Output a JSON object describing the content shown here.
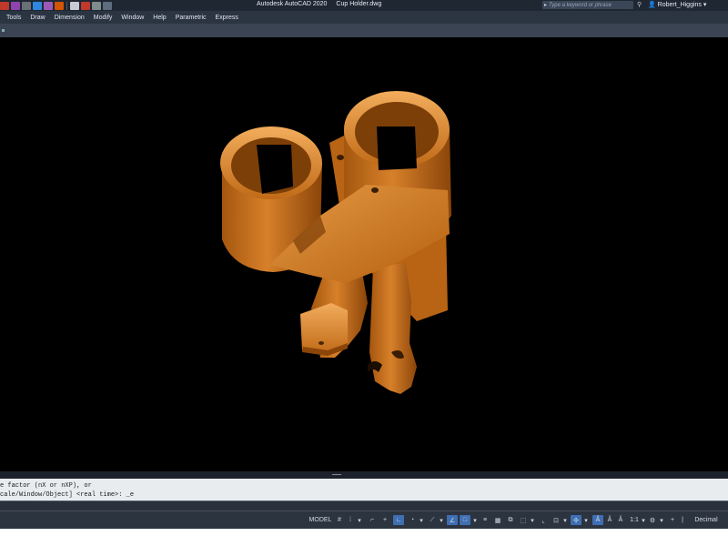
{
  "title": {
    "app": "Autodesk AutoCAD 2020",
    "file": "Cup Holder.dwg"
  },
  "search": {
    "placeholder": "Type a keyword or phrase"
  },
  "user": {
    "name": "Robert_Higgins"
  },
  "menu": {
    "items": [
      "Tools",
      "Draw",
      "Dimension",
      "Modify",
      "Window",
      "Help",
      "Parametric",
      "Express"
    ]
  },
  "command": {
    "line1": "e factor (nX or nXP), or",
    "line2": "cale/Window/Object] <real time>: _e"
  },
  "status": {
    "model": "MODEL",
    "scale": "1:1",
    "units": "Decimal"
  },
  "colors": {
    "model_fill": "#c56d16",
    "model_light": "#f0a752",
    "model_dark": "#6f3806",
    "status_active": "#3f6fb3"
  },
  "icons": [
    "save-icon",
    "undo-icon",
    "grid-icon",
    "snap-icon",
    "ortho-icon",
    "polar-icon",
    "osnap-icon",
    "annotation-icon",
    "workspace-gear-icon",
    "plus-icon"
  ]
}
